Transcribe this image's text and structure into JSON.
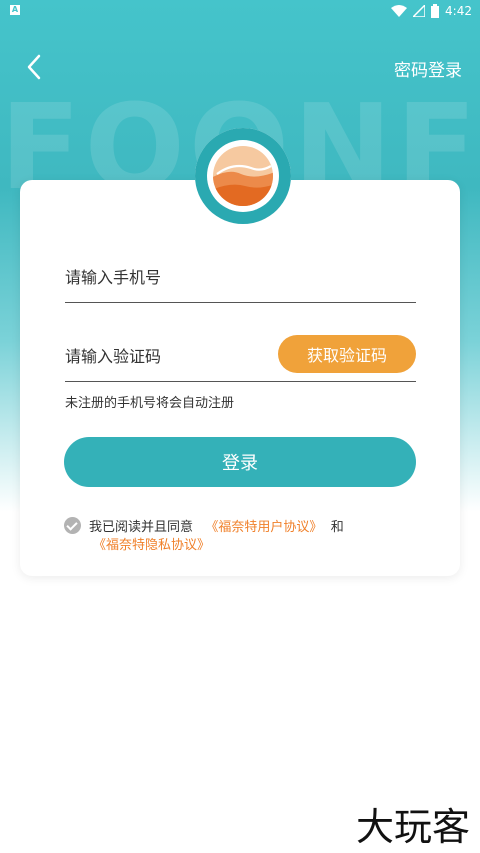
{
  "status_bar": {
    "left_icon_label": "A",
    "time": "4:42",
    "icons": [
      "wifi-icon",
      "signal-icon",
      "battery-icon"
    ]
  },
  "background_watermark": "FOONFT",
  "header": {
    "back_icon": "chevron-left-icon",
    "password_login_label": "密码登录"
  },
  "form": {
    "phone_placeholder": "请输入手机号",
    "code_placeholder": "请输入验证码",
    "get_code_label": "获取验证码",
    "hint": "未注册的手机号将会自动注册",
    "login_label": "登录"
  },
  "agreement": {
    "prefix": "我已阅读并且同意",
    "user_agreement": "《福奈特用户协议》",
    "and": "和",
    "privacy_agreement": "《福奈特隐私协议》"
  },
  "brand_watermark": "大玩客",
  "colors": {
    "primary": "#34b1b8",
    "accent_orange": "#f0a23a",
    "link_orange": "#f0802a"
  }
}
